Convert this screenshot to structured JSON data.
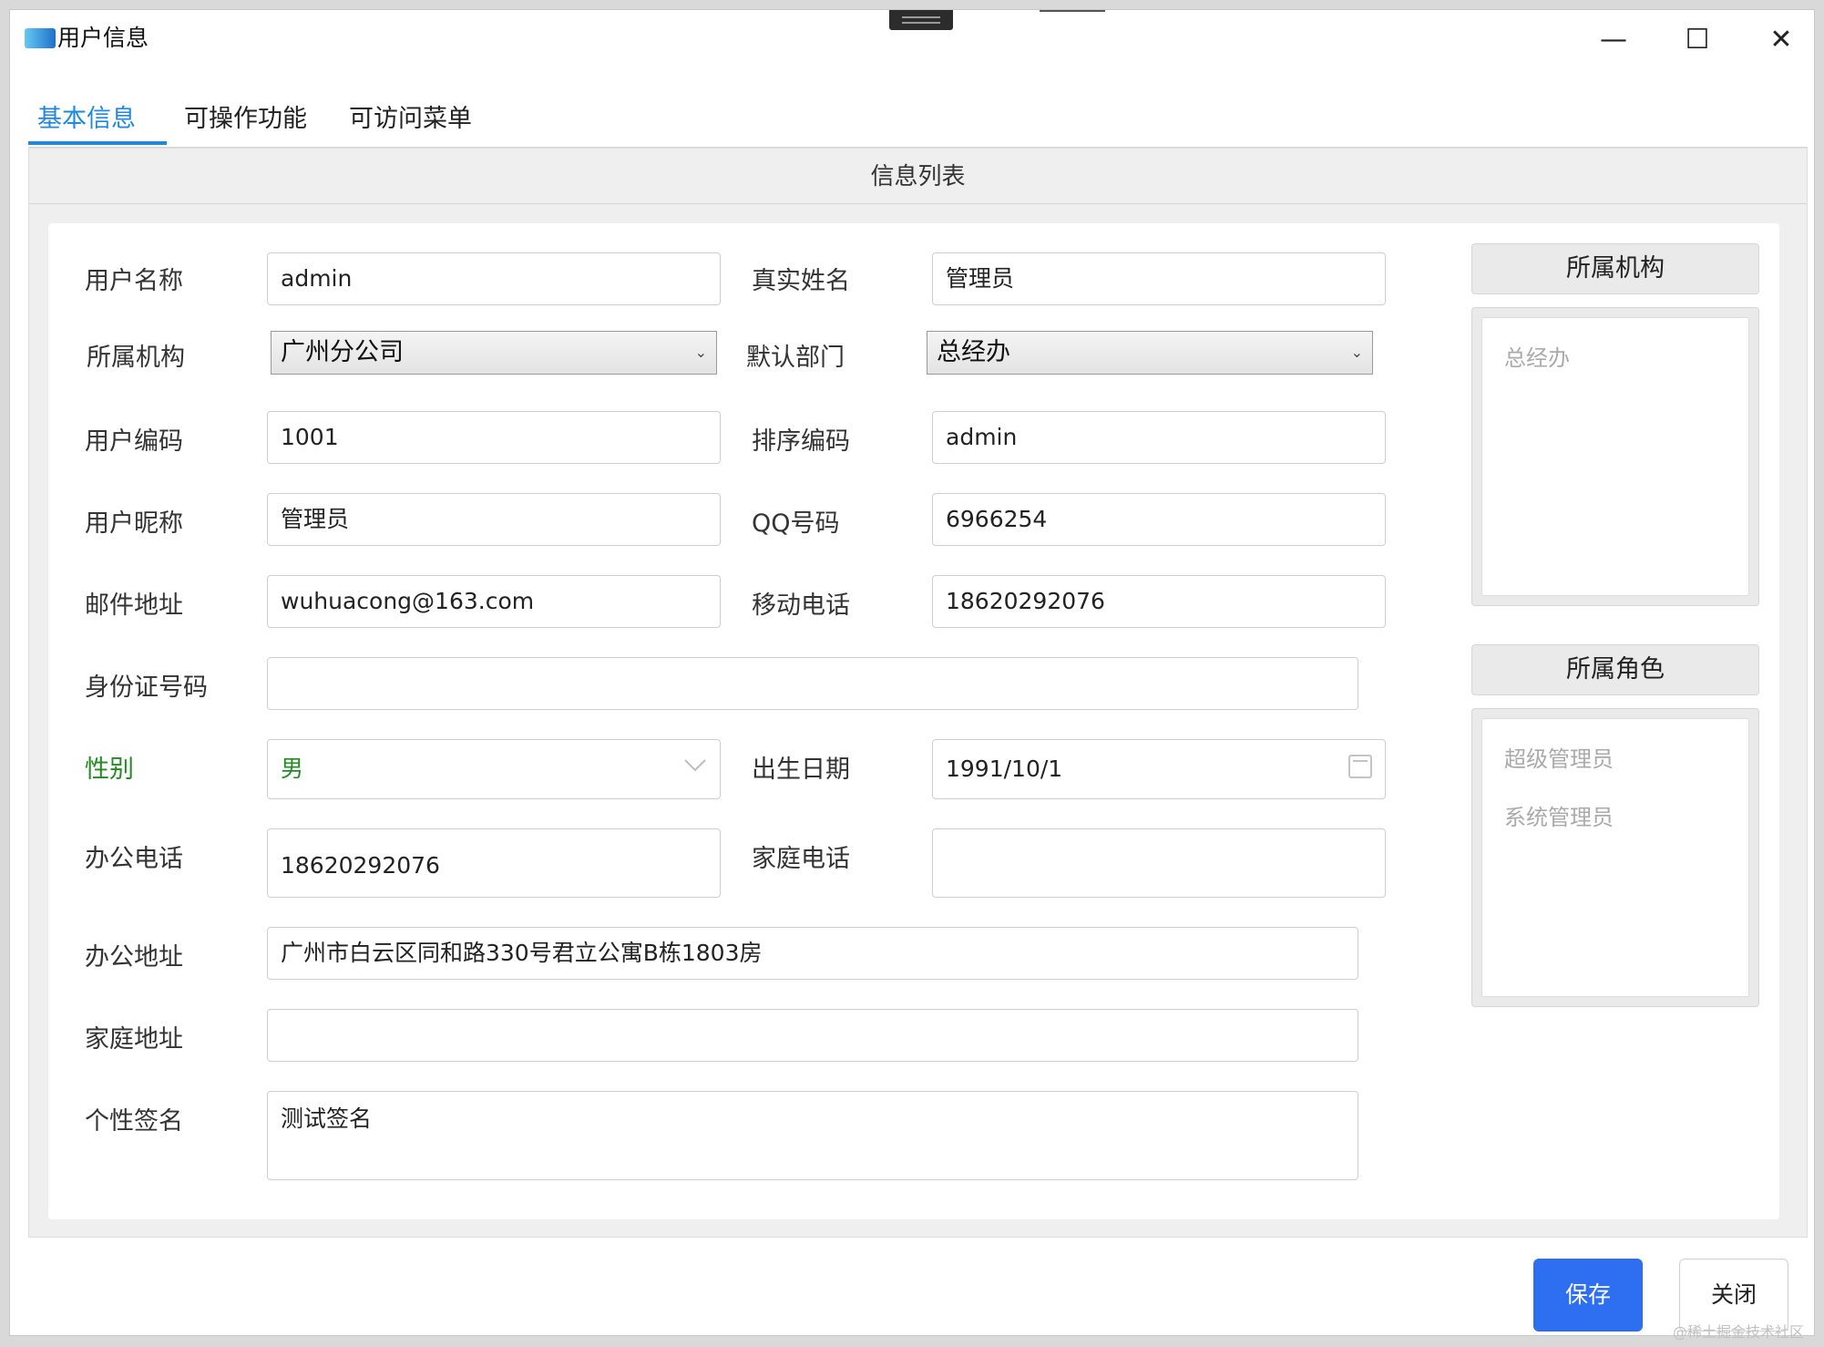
{
  "window": {
    "title": "用户信息",
    "minimize": "—",
    "maximize": "☐",
    "close": "✕"
  },
  "tabs": [
    {
      "label": "基本信息",
      "active": true
    },
    {
      "label": "可操作功能",
      "active": false
    },
    {
      "label": "可访问菜单",
      "active": false
    }
  ],
  "panel": {
    "header": "信息列表"
  },
  "form": {
    "username": {
      "label": "用户名称",
      "value": "admin"
    },
    "real_name": {
      "label": "真实姓名",
      "value": "管理员"
    },
    "org": {
      "label": "所属机构",
      "value": "广州分公司"
    },
    "dept": {
      "label": "默认部门",
      "value": "总经办"
    },
    "user_code": {
      "label": "用户编码",
      "value": "1001"
    },
    "sort_code": {
      "label": "排序编码",
      "value": "admin"
    },
    "nickname": {
      "label": "用户昵称",
      "value": "管理员"
    },
    "qq": {
      "label": "QQ号码",
      "value": "6966254"
    },
    "email": {
      "label": "邮件地址",
      "value": "wuhuacong@163.com"
    },
    "mobile": {
      "label": "移动电话",
      "value": "18620292076"
    },
    "id_card": {
      "label": "身份证号码",
      "value": ""
    },
    "gender": {
      "label": "性别",
      "value": "男"
    },
    "birthday": {
      "label": "出生日期",
      "value": "1991/10/1"
    },
    "office_phone": {
      "label": "办公电话",
      "value": "18620292076"
    },
    "home_phone": {
      "label": "家庭电话",
      "value": ""
    },
    "office_address": {
      "label": "办公地址",
      "value": "广州市白云区同和路330号君立公寓B栋1803房"
    },
    "home_address": {
      "label": "家庭地址",
      "value": ""
    },
    "signature": {
      "label": "个性签名",
      "value": "测试签名"
    }
  },
  "sidebar": {
    "org_header": "所属机构",
    "org_items": [
      "总经办"
    ],
    "role_header": "所属角色",
    "role_items": [
      "超级管理员",
      "系统管理员"
    ]
  },
  "buttons": {
    "save": "保存",
    "close": "关闭"
  },
  "watermark": "@稀土掘金技术社区",
  "colors": {
    "accent": "#1e88e5",
    "save_button": "#2d6ff0",
    "gender_label": "#228b22"
  }
}
